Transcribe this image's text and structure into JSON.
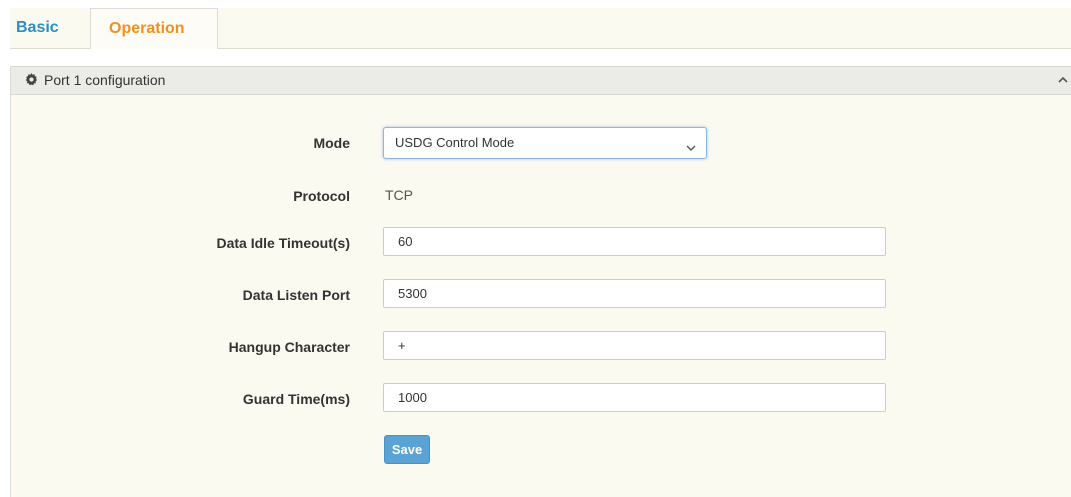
{
  "tabs": [
    {
      "label": "Basic"
    },
    {
      "label": "Operation"
    }
  ],
  "panel": {
    "title": "Port 1 configuration",
    "icon": "gear-icon",
    "collapse_icon": "chevron-up-icon"
  },
  "form": {
    "mode": {
      "label": "Mode",
      "value": "USDG Control Mode"
    },
    "protocol": {
      "label": "Protocol",
      "value": "TCP"
    },
    "data_idle_timeout": {
      "label": "Data Idle Timeout(s)",
      "value": "60"
    },
    "data_listen_port": {
      "label": "Data Listen Port",
      "value": "5300"
    },
    "hangup_character": {
      "label": "Hangup Character",
      "value": "+"
    },
    "guard_time": {
      "label": "Guard Time(ms)",
      "value": "1000"
    },
    "save_label": "Save"
  },
  "colors": {
    "tab_basic": "#2a8fc2",
    "tab_active": "#f0901f",
    "save_button": "#5aa3d6",
    "panel_background": "#fbfaf1"
  }
}
